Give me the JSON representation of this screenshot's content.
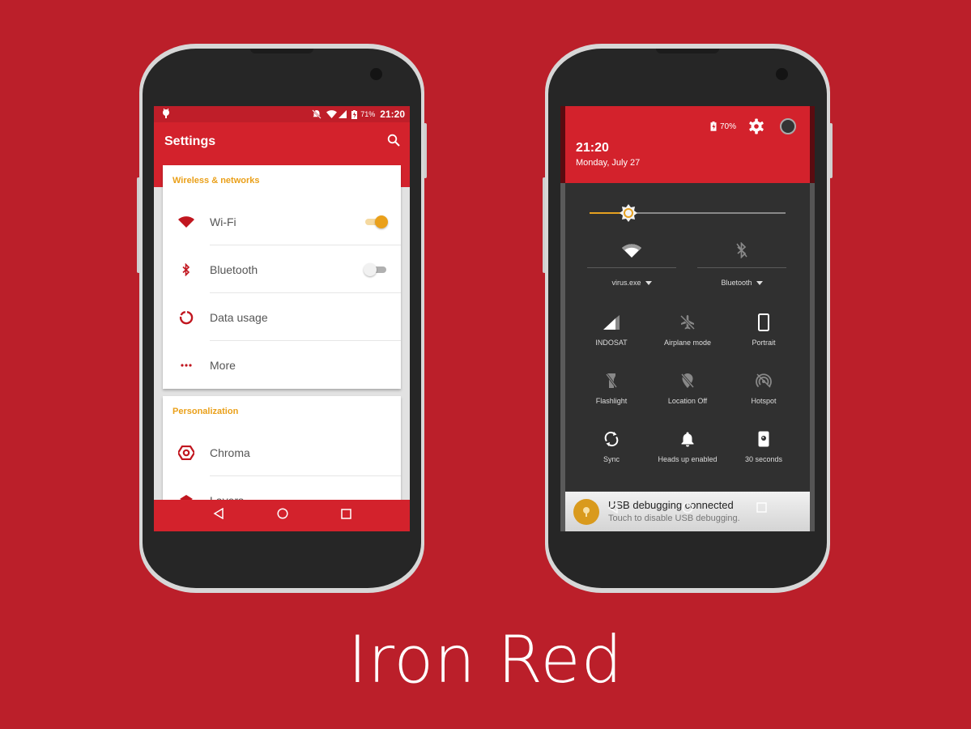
{
  "brand": {
    "title": "Iron Red",
    "background": "#bb1f2a",
    "accent": "#d3222c",
    "highlight": "#eaa01a"
  },
  "left_phone": {
    "statusbar": {
      "battery_pct": "71%",
      "time": "21:20",
      "icons": [
        "android-icon",
        "mute-icon",
        "wifi-icon",
        "signal-icon",
        "battery-icon"
      ]
    },
    "appbar": {
      "title": "Settings",
      "action_icon": "search-icon"
    },
    "sections": [
      {
        "header": "Wireless & networks",
        "items": [
          {
            "label": "Wi-Fi",
            "icon": "wifi-icon",
            "toggle": true,
            "toggle_on": true
          },
          {
            "label": "Bluetooth",
            "icon": "bluetooth-icon",
            "toggle": true,
            "toggle_on": false
          },
          {
            "label": "Data usage",
            "icon": "data-usage-icon"
          },
          {
            "label": "More",
            "icon": "more-icon"
          }
        ]
      },
      {
        "header": "Personalization",
        "items": [
          {
            "label": "Chroma",
            "icon": "chroma-icon"
          },
          {
            "label": "Layers",
            "icon": "layers-icon"
          }
        ]
      }
    ],
    "navbar": [
      "back",
      "home",
      "recents"
    ]
  },
  "right_phone": {
    "header": {
      "battery_pct": "70%",
      "time": "21:20",
      "date": "Monday, July 27"
    },
    "brightness": {
      "level": 0.2
    },
    "big_tiles": [
      {
        "label": "virus.exe",
        "icon": "wifi-icon",
        "active": true
      },
      {
        "label": "Bluetooth",
        "icon": "bluetooth-off-icon",
        "active": false
      }
    ],
    "tiles": [
      {
        "label": "INDOSAT",
        "icon": "signal-icon",
        "active": true
      },
      {
        "label": "Airplane mode",
        "icon": "airplane-off-icon",
        "active": false
      },
      {
        "label": "Portrait",
        "icon": "portrait-icon",
        "active": true
      },
      {
        "label": "Flashlight",
        "icon": "flashlight-off-icon",
        "active": false
      },
      {
        "label": "Location Off",
        "icon": "location-off-icon",
        "active": false
      },
      {
        "label": "Hotspot",
        "icon": "hotspot-off-icon",
        "active": false
      },
      {
        "label": "Sync",
        "icon": "sync-icon",
        "active": true
      },
      {
        "label": "Heads up enabled",
        "icon": "bell-icon",
        "active": true
      },
      {
        "label": "30 seconds",
        "icon": "screen-timeout-icon",
        "active": true
      }
    ],
    "notification": {
      "title": "USB debugging connected",
      "text": "Touch to disable USB debugging."
    }
  }
}
